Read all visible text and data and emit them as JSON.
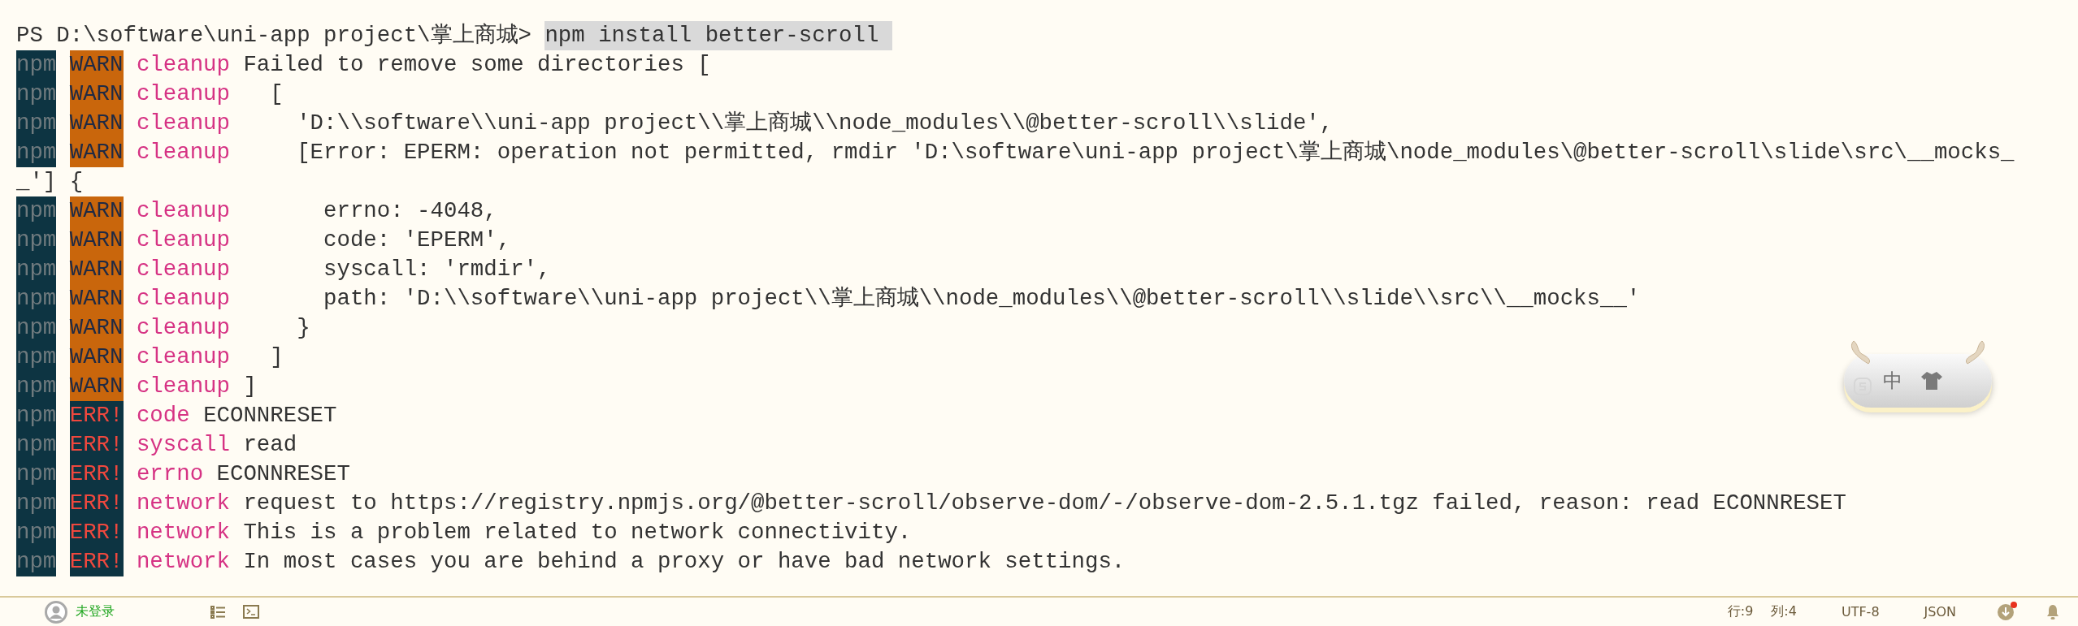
{
  "terminal": {
    "lines": [
      {
        "kind": "prompt",
        "prompt": "PS D:\\software\\uni-app project\\掌上商城>",
        "command": "npm install better-scroll "
      },
      {
        "kind": "warn",
        "prefix": "npm",
        "level": "WARN",
        "topic": "cleanup",
        "message": "Failed to remove some directories ["
      },
      {
        "kind": "warn",
        "prefix": "npm",
        "level": "WARN",
        "topic": "cleanup",
        "message": "  ["
      },
      {
        "kind": "warn",
        "prefix": "npm",
        "level": "WARN",
        "topic": "cleanup",
        "message": "    'D:\\\\software\\\\uni-app project\\\\掌上商城\\\\node_modules\\\\@better-scroll\\\\slide',"
      },
      {
        "kind": "warn",
        "prefix": "npm",
        "level": "WARN",
        "topic": "cleanup",
        "message": "    [Error: EPERM: operation not permitted, rmdir 'D:\\software\\uni-app project\\掌上商城\\node_modules\\@better-scroll\\slide\\src\\__mocks_"
      },
      {
        "kind": "wrap",
        "message": "_'] {"
      },
      {
        "kind": "warn",
        "prefix": "npm",
        "level": "WARN",
        "topic": "cleanup",
        "message": "      errno: -4048,"
      },
      {
        "kind": "warn",
        "prefix": "npm",
        "level": "WARN",
        "topic": "cleanup",
        "message": "      code: 'EPERM',"
      },
      {
        "kind": "warn",
        "prefix": "npm",
        "level": "WARN",
        "topic": "cleanup",
        "message": "      syscall: 'rmdir',"
      },
      {
        "kind": "warn",
        "prefix": "npm",
        "level": "WARN",
        "topic": "cleanup",
        "message": "      path: 'D:\\\\software\\\\uni-app project\\\\掌上商城\\\\node_modules\\\\@better-scroll\\\\slide\\\\src\\\\__mocks__'"
      },
      {
        "kind": "warn",
        "prefix": "npm",
        "level": "WARN",
        "topic": "cleanup",
        "message": "    }"
      },
      {
        "kind": "warn",
        "prefix": "npm",
        "level": "WARN",
        "topic": "cleanup",
        "message": "  ]"
      },
      {
        "kind": "warn",
        "prefix": "npm",
        "level": "WARN",
        "topic": "cleanup",
        "message": "]"
      },
      {
        "kind": "err",
        "prefix": "npm",
        "level": "ERR!",
        "topic": "code",
        "message": "ECONNRESET"
      },
      {
        "kind": "err",
        "prefix": "npm",
        "level": "ERR!",
        "topic": "syscall",
        "message": "read"
      },
      {
        "kind": "err",
        "prefix": "npm",
        "level": "ERR!",
        "topic": "errno",
        "message": "ECONNRESET"
      },
      {
        "kind": "err",
        "prefix": "npm",
        "level": "ERR!",
        "topic": "network",
        "message": "request to https://registry.npmjs.org/@better-scroll/observe-dom/-/observe-dom-2.5.1.tgz failed, reason: read ECONNRESET"
      },
      {
        "kind": "err",
        "prefix": "npm",
        "level": "ERR!",
        "topic": "network",
        "message": "This is a problem related to network connectivity."
      },
      {
        "kind": "err",
        "prefix": "npm",
        "level": "ERR!",
        "topic": "network",
        "message": "In most cases you are behind a proxy or have bad network settings."
      }
    ]
  },
  "ime_toolbar": {
    "mode": "中"
  },
  "status_bar": {
    "login": "未登录",
    "line": "行:9",
    "column": "列:4",
    "encoding": "UTF-8",
    "language": "JSON",
    "update_badge": true
  }
}
